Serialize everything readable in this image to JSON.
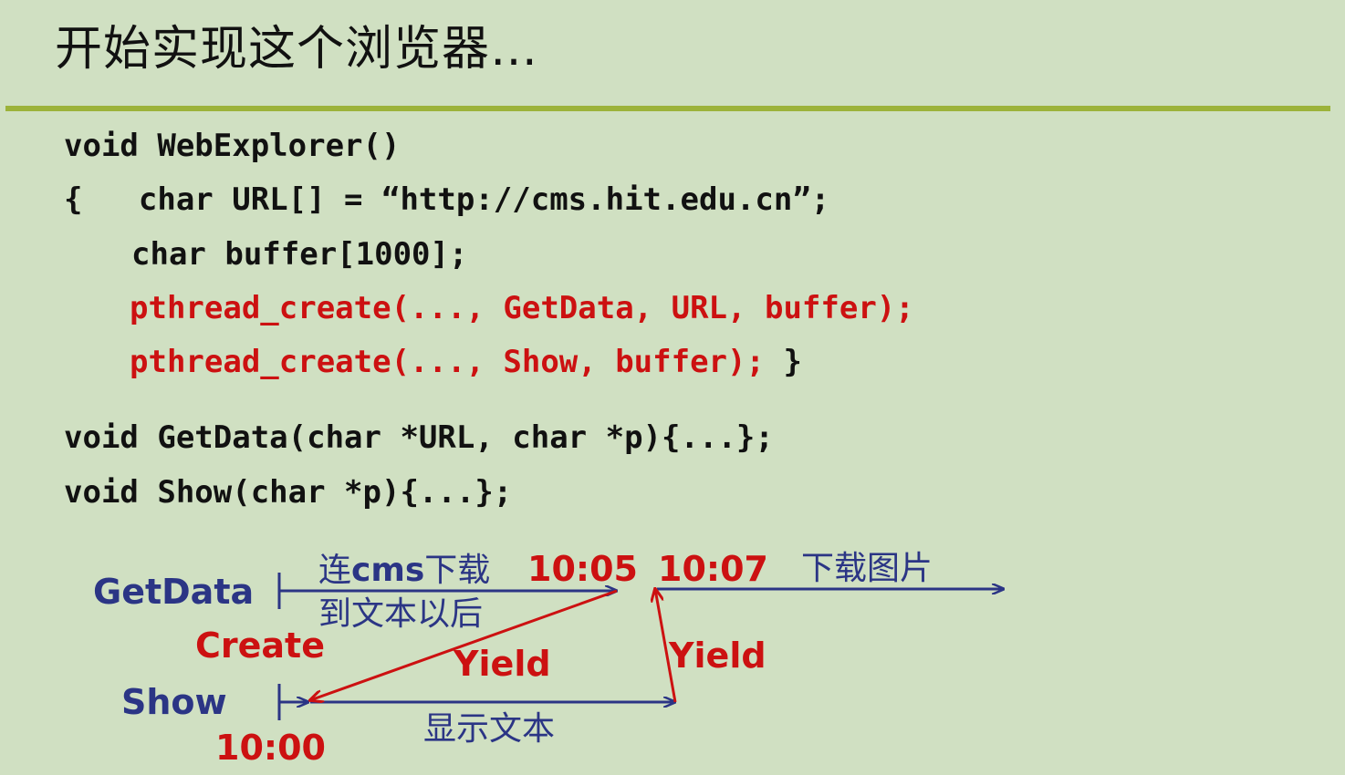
{
  "title": "开始实现这个浏览器…",
  "code": {
    "line1": "void WebExplorer()",
    "line2": "{   char URL[] = “http://cms.hit.edu.cn”;",
    "line3": "char buffer[1000];",
    "line4": "pthread_create(..., GetData, URL, buffer);",
    "line5_red": "pthread_create(..., Show, buffer);",
    "line5_end": " }",
    "line6": "void GetData(char *URL, char *p){...};",
    "line7": "void Show(char *p){...};"
  },
  "diagram": {
    "getdata_label": "GetData",
    "show_label": "Show",
    "create_label": "Create",
    "yield_label_1": "Yield",
    "yield_label_2": "Yield",
    "time_1000": "10:00",
    "time_1005": "10:05",
    "time_1007": "10:07",
    "download_prefix": "连",
    "download_cms": "cms",
    "download_suffix": "下载",
    "after_text": "到文本以后",
    "download_image": "下载图片",
    "show_text": "显示文本"
  },
  "colors": {
    "background": "#d0e0c2",
    "rule": "#9cb33a",
    "navy": "#2b3585",
    "red": "#cc1111"
  }
}
